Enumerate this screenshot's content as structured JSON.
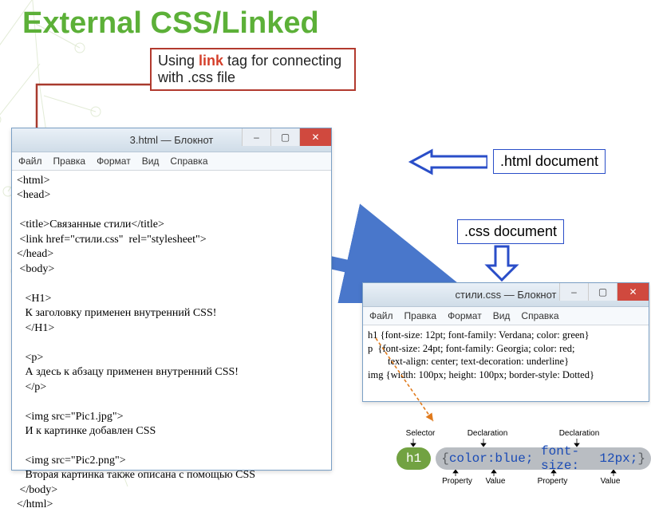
{
  "title": "External CSS/Linked",
  "callout": {
    "prefix": "Using ",
    "highlight": "link",
    "suffix": " tag for connecting with .css file"
  },
  "labels": {
    "html_doc": ".html document",
    "css_doc": ".css document"
  },
  "notepad_html": {
    "title": "3.html — Блокнот",
    "menu": [
      "Файл",
      "Правка",
      "Формат",
      "Вид",
      "Справка"
    ],
    "content": "<html>\n<head>\n\n <title>Связанные стили</title>\n <link href=\"стили.css\"  rel=\"stylesheet\">\n</head>\n <body>\n\n   <H1>\n   К заголовку применен внутренний CSS!\n   </H1>\n\n   <p>\n   А здесь к абзацу применен внутренний CSS!\n   </p>\n\n   <img src=\"Pic1.jpg\">\n   И к картинке добавлен CSS\n\n   <img src=\"Pic2.png\">\n   Вторая картинка также описана с помощью CSS\n </body>\n</html>"
  },
  "notepad_css": {
    "title": "стили.css — Блокнот",
    "menu": [
      "Файл",
      "Правка",
      "Формат",
      "Вид",
      "Справка"
    ],
    "content": "h1 {font-size: 12pt; font-family: Verdana; color: green}\np  {font-size: 24pt; font-family: Georgia; color: red;\n        text-align: center; text-decoration: underline}\nimg {width: 100px; height: 100px; border-style: Dotted}"
  },
  "syntax": {
    "top_labels": {
      "selector": "Selector",
      "decl1": "Declaration",
      "decl2": "Declaration"
    },
    "selector": "h1",
    "brace_open": "{",
    "prop1": "color:",
    "val1": "blue;",
    "prop2": "font-size:",
    "val2": "12px;",
    "brace_close": "}",
    "bottom_labels": {
      "p1": "Property",
      "v1": "Value",
      "p2": "Property",
      "v2": "Value"
    }
  },
  "colors": {
    "accent": "#5cb038",
    "callout_border": "#b23a2e",
    "blue": "#2a4ec8"
  }
}
